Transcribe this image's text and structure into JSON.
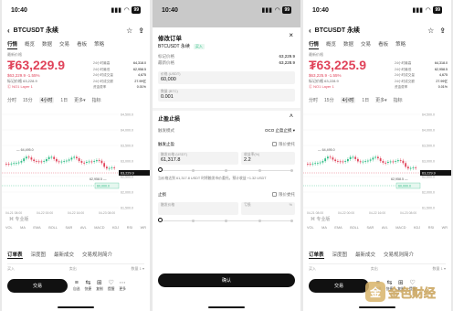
{
  "left": {
    "time": "10:40",
    "battery": "99",
    "title": "BTCUSDT 永续",
    "tabs": [
      "行情",
      "概览",
      "数据",
      "交易",
      "看板",
      "策略"
    ],
    "last_label": "最新价格",
    "price": "₮63,229.9",
    "change": "$63,229.9  -1.55%",
    "mark": "标记价格 63,228.9",
    "tags": "Ⓒ NO1   Layer 1",
    "stats": [
      [
        "24小时最高",
        "64,318.0"
      ],
      [
        "24小时最低",
        "62,958.5"
      ],
      [
        "24小时成交量",
        "4,675"
      ],
      [
        "24小时成交额",
        "27.99亿"
      ],
      [
        "资金费率",
        "0.01%"
      ]
    ],
    "intervals": [
      "分时",
      "15分",
      "4小时",
      "1日",
      "更多▾",
      "指标"
    ],
    "vol_labels": [
      "VOL",
      "MA",
      "EMA",
      "BOLL",
      "SAR",
      "AVL",
      "MACD",
      "KDJ",
      "RSI",
      "WR"
    ],
    "pro": "⌘ 专业版",
    "sections": [
      "订单表",
      "深度图",
      "最新成交",
      "交易规则简介"
    ],
    "filter_left": "买入",
    "filter_mid": "卖出",
    "filter_right": "数量 1 ▾",
    "trade": "交易",
    "icons": [
      [
        "≡",
        "自选"
      ],
      [
        "⇆",
        "快捷"
      ],
      [
        "⊞",
        "复制"
      ],
      [
        "♡",
        "提醒"
      ],
      [
        "⋯",
        "更多"
      ]
    ]
  },
  "middle": {
    "time": "10:40",
    "battery": "99",
    "title": "修改订单",
    "subtitle": "BTCUSDT 永续",
    "badge": "买入",
    "rows": [
      [
        "标记价格",
        "63,229.9"
      ],
      [
        "最新价格",
        "63,228.9"
      ]
    ],
    "price_label": "价格 (USDT)",
    "price_value": "60,000",
    "qty_label": "数量 (BTC)",
    "qty_value": "0.001",
    "section": "止盈止损",
    "mode_label": "触发模式",
    "mode_value": "OCO 止盈止损 ▾",
    "tp_label": "触发止盈",
    "tp_check": "限价委托",
    "tp_trigger_label": "触发价格 (USDT)",
    "tp_trigger": "61,317.8",
    "tp_pnl_label": "收益率(%)",
    "tp_pnl": "2.2",
    "note": "当价格达到 61,317.8 USDT 时将触发市价委托，预计收益 +1.32 USDT",
    "sl_label": "止损",
    "sl_check": "限价委托",
    "sl_trigger_label": "触发价格",
    "sl_pnl_label": "亏损",
    "sl_pct_label": "%",
    "confirm": "确认"
  },
  "right": {
    "time": "10:40",
    "battery": "99",
    "title": "BTCUSDT 永续",
    "tabs": [
      "行情",
      "概览",
      "数据",
      "交易",
      "看板",
      "策略"
    ],
    "last_label": "最新价格",
    "price": "₮63,225.9",
    "change": "$63,225.9  -1.55%",
    "mark": "标记价格 63,228.9",
    "tags": "Ⓒ NO1   Layer 1",
    "stats": [
      [
        "24小时最高",
        "64,318.0"
      ],
      [
        "24小时最低",
        "62,958.5"
      ],
      [
        "24小时成交量",
        "4,675"
      ],
      [
        "24小时成交额",
        "27.99亿"
      ],
      [
        "资金费率",
        "0.01%"
      ]
    ],
    "intervals": [
      "分时",
      "15分",
      "4小时",
      "1日",
      "更多▾",
      "指标"
    ],
    "vol_labels": [
      "VOL",
      "MA",
      "EMA",
      "BOLL",
      "SAR",
      "AVL",
      "MACD",
      "KDJ",
      "RSI",
      "WR"
    ],
    "pro": "⌘ 专业版",
    "sections": [
      "订单表",
      "深度图",
      "最新成交",
      "交易规则简介"
    ],
    "filter_left": "买入",
    "filter_mid": "卖出",
    "filter_right": "数量 1 ▾",
    "trade": "交易",
    "icons": [
      [
        "≡",
        "自选"
      ],
      [
        "⇆",
        "快捷"
      ],
      [
        "⊞",
        "复制"
      ],
      [
        "♡",
        "提醒"
      ],
      [
        "⋯",
        "更多"
      ]
    ]
  },
  "chart": {
    "high_label": "64,495.0",
    "low_label": "62,958.5",
    "last_tag": "63,229.9",
    "order_tag": "60,000.0",
    "y_ticks": [
      "64,500.0",
      "64,000.0",
      "63,500.0",
      "63,000.0",
      "62,500.0",
      "62,000.0",
      "61,500.0"
    ],
    "x_ticks": [
      "04-21 08:00",
      "04-22 00:00",
      "04-22 16:00",
      "04-23 08:00"
    ],
    "colors": {
      "up": "#2ebd85",
      "down": "#e0435a"
    }
  },
  "watermark": "金色财经"
}
